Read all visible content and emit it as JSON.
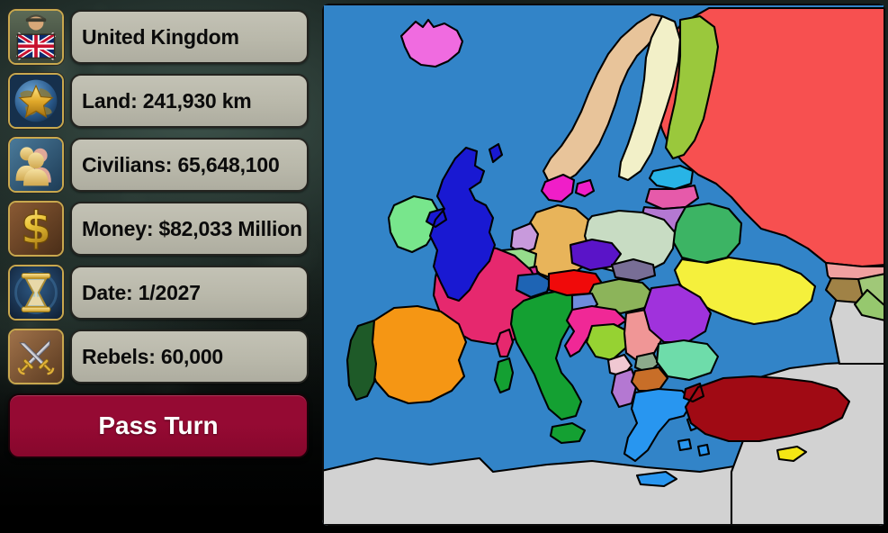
{
  "app": {
    "title": "Age of Civilizations - Europe",
    "background_color": "#18211e"
  },
  "sidebar": {
    "stats": [
      {
        "id": "country",
        "icon": "leader-flag-icon",
        "label": "United Kingdom",
        "value": "United Kingdom"
      },
      {
        "id": "land",
        "icon": "globe-star-icon",
        "label": "Land: 241,930 km",
        "value": "241,930 km"
      },
      {
        "id": "civilians",
        "icon": "people-icon",
        "label": "Civilians: 65,648,100",
        "value": "65,648,100"
      },
      {
        "id": "money",
        "icon": "dollar-icon",
        "label": "Money: $82,033 Million",
        "value": "$82,033 Million"
      },
      {
        "id": "date",
        "icon": "hourglass-icon",
        "label": "Date: 1/2027",
        "value": "1/2027"
      },
      {
        "id": "rebels",
        "icon": "crossed-swords-icon",
        "label": "Rebels: 60,000",
        "value": "60,000"
      }
    ],
    "pass_turn_label": "Pass Turn",
    "panel_color": "#bab9ab",
    "panel_text_color": "#0b0b0b",
    "pass_turn_color": "#950a33",
    "icon_border_color": "#c8a84e"
  },
  "map": {
    "sea_color": "#3284c8",
    "border_color": "#000000",
    "neutral_color": "#d2d2d2",
    "selected_country": "United Kingdom",
    "region": "Europe",
    "countries": [
      {
        "name": "Iceland",
        "color": "#f06be0"
      },
      {
        "name": "United Kingdom",
        "color": "#1919d2"
      },
      {
        "name": "Ireland",
        "color": "#78e68c"
      },
      {
        "name": "Norway",
        "color": "#e8c49a"
      },
      {
        "name": "Sweden",
        "color": "#f2f0c8"
      },
      {
        "name": "Finland",
        "color": "#9ac83c"
      },
      {
        "name": "Denmark",
        "color": "#f01ec8"
      },
      {
        "name": "Russia",
        "color": "#f75050"
      },
      {
        "name": "Estonia",
        "color": "#28b4e6"
      },
      {
        "name": "Latvia",
        "color": "#e65aaa"
      },
      {
        "name": "Lithuania",
        "color": "#b478d2"
      },
      {
        "name": "Belarus",
        "color": "#3cb464"
      },
      {
        "name": "Poland",
        "color": "#c8dcc3"
      },
      {
        "name": "Ukraine",
        "color": "#f5f03c"
      },
      {
        "name": "Germany",
        "color": "#e8b45a"
      },
      {
        "name": "Netherlands",
        "color": "#c89adc"
      },
      {
        "name": "Belgium",
        "color": "#96dc8c"
      },
      {
        "name": "Luxembourg",
        "color": "#d22896"
      },
      {
        "name": "France",
        "color": "#e6286e"
      },
      {
        "name": "Spain",
        "color": "#f59614"
      },
      {
        "name": "Portugal",
        "color": "#1e5a28"
      },
      {
        "name": "Italy",
        "color": "#14a032"
      },
      {
        "name": "Switzerland",
        "color": "#1e64b4"
      },
      {
        "name": "Austria",
        "color": "#f00a0a"
      },
      {
        "name": "Czechia",
        "color": "#5a14c8"
      },
      {
        "name": "Slovakia",
        "color": "#786e96"
      },
      {
        "name": "Hungary",
        "color": "#8cb45a"
      },
      {
        "name": "Slovenia",
        "color": "#6e8cdc"
      },
      {
        "name": "Croatia",
        "color": "#f02896"
      },
      {
        "name": "Bosnia",
        "color": "#96d232"
      },
      {
        "name": "Serbia",
        "color": "#f09696"
      },
      {
        "name": "Montenegro",
        "color": "#f0c8d2"
      },
      {
        "name": "Kosovo",
        "color": "#8caa8c"
      },
      {
        "name": "Albania",
        "color": "#b478d2"
      },
      {
        "name": "Macedonia",
        "color": "#c86e28"
      },
      {
        "name": "Romania",
        "color": "#a032dc"
      },
      {
        "name": "Moldova",
        "color": "#dcc896"
      },
      {
        "name": "Bulgaria",
        "color": "#6edcaa"
      },
      {
        "name": "Greece",
        "color": "#2896f0"
      },
      {
        "name": "Turkey",
        "color": "#a00a14"
      },
      {
        "name": "Cyprus",
        "color": "#f5e614"
      },
      {
        "name": "Georgia",
        "color": "#a08246"
      },
      {
        "name": "Armenia",
        "color": "#a0c878"
      },
      {
        "name": "Azerbaijan",
        "color": "#96c86e"
      },
      {
        "name": "Kazakhstan",
        "color": "#f0a0a0"
      },
      {
        "name": "Neutral Land",
        "color": "#d2d2d2"
      }
    ]
  }
}
